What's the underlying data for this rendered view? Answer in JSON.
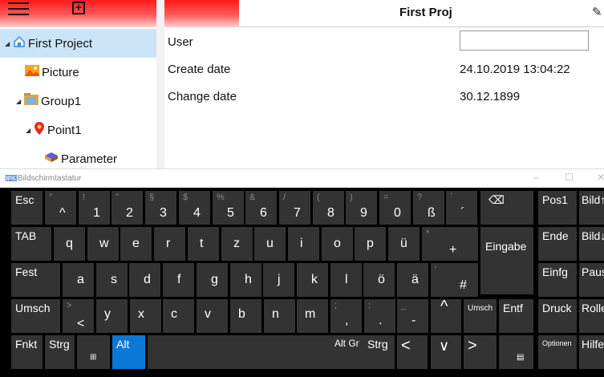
{
  "toolbar": {
    "menu_icon": "hamburger-icon",
    "add_icon": "add-box-icon"
  },
  "tree": {
    "items": [
      {
        "label": "First Project",
        "icon": "project-home-icon"
      },
      {
        "label": "Picture",
        "icon": "picture-icon"
      },
      {
        "label": "Group1",
        "icon": "group-icon"
      },
      {
        "label": "Point1",
        "icon": "location-pin-icon"
      },
      {
        "label": "Parameter",
        "icon": "parameter-book-icon"
      }
    ]
  },
  "header": {
    "title": "First Proj",
    "edit_icon": "pencil-icon"
  },
  "properties": [
    {
      "label": "User",
      "value": ""
    },
    {
      "label": "Create date",
      "value": "24.10.2019 13:04:22"
    },
    {
      "label": "Change date",
      "value": "30.12.1899"
    }
  ],
  "keyboard": {
    "title": "Bildschirmtastatur",
    "window_buttons": [
      "–",
      "☐",
      "✕"
    ],
    "row1": [
      {
        "top": "°",
        "main": "^"
      },
      {
        "top": "!",
        "main": "1"
      },
      {
        "top": "\"",
        "main": "2"
      },
      {
        "top": "§",
        "main": "3"
      },
      {
        "top": "$",
        "main": "4"
      },
      {
        "top": "%",
        "main": "5"
      },
      {
        "top": "&",
        "main": "6"
      },
      {
        "top": "/",
        "main": "7"
      },
      {
        "top": "(",
        "main": "8"
      },
      {
        "top": ")",
        "main": "9"
      },
      {
        "top": "=",
        "main": "0"
      },
      {
        "top": "?",
        "main": "ß"
      },
      {
        "top": "`",
        "main": "´"
      }
    ],
    "row2": [
      "q",
      "w",
      "e",
      "r",
      "t",
      "z",
      "u",
      "i",
      "o",
      "p",
      "ü"
    ],
    "row2_plus": {
      "top": "*",
      "main": "+"
    },
    "row3": [
      "a",
      "s",
      "d",
      "f",
      "g",
      "h",
      "j",
      "k",
      "l",
      "ö",
      "ä"
    ],
    "row3_hash": {
      "top": "'",
      "main": "#"
    },
    "row4_lt": {
      "top": ">",
      "main": "<"
    },
    "row4": [
      "y",
      "x",
      "c",
      "v",
      "b",
      "n",
      "m"
    ],
    "row4_punct": [
      {
        "top": ";",
        "main": ","
      },
      {
        "top": ":",
        "main": "."
      },
      {
        "top": "_",
        "main": "-"
      }
    ],
    "keys": {
      "esc": "Esc",
      "backspace": "⌫",
      "tab": "TAB",
      "enter": "Eingabe",
      "caps": "Fest",
      "shift": "Umsch",
      "up": "^",
      "shift_right": "Umsch",
      "delete": "Entf",
      "fn": "Fnkt",
      "ctrl": "Strg",
      "win": "⊞",
      "alt": "Alt",
      "altgr": "Alt Gr",
      "ctrl_right": "Strg",
      "left": "<",
      "down": "∨",
      "right": ">",
      "menu": "▤",
      "pos1": "Pos1",
      "pgup": "Bild↑",
      "end": "Ende",
      "pgdn": "Bild↓",
      "insert": "Einfg",
      "pause": "Pause",
      "print": "Druck",
      "scroll": "Rollen",
      "options": "Optionen",
      "help": "Hilfe"
    }
  }
}
